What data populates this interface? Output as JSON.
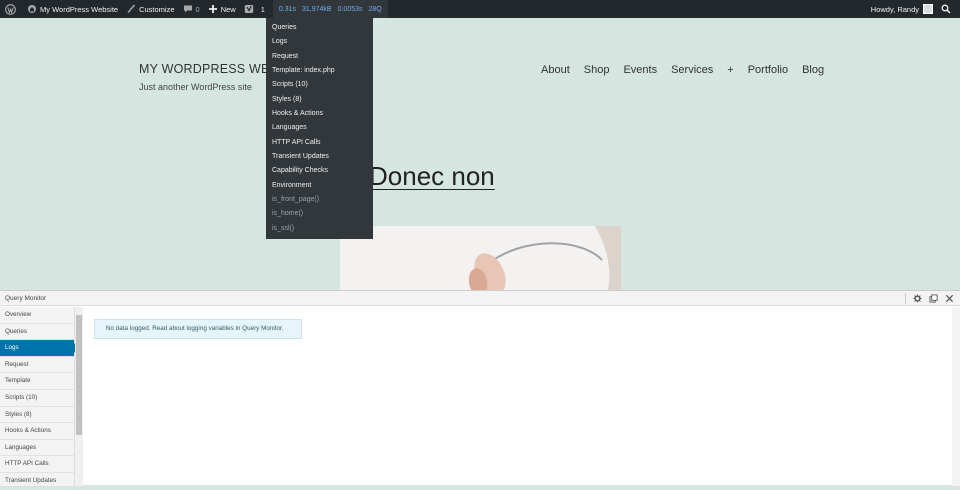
{
  "admin_bar": {
    "site_name": "My WordPress Website",
    "customize": "Customize",
    "comments_count": "0",
    "new_label": "New",
    "yoast_count": "1",
    "qm_stats": [
      "0.31s",
      "31,974kB",
      "0.0053s",
      "28Q"
    ],
    "howdy": "Howdy, Randy"
  },
  "qm_menu": {
    "items": [
      "Queries",
      "Logs",
      "Request",
      "Template: index.php",
      "Scripts (10)",
      "Styles (8)",
      "Hooks & Actions",
      "Languages",
      "HTTP API Calls",
      "Transient Updates",
      "Capability Checks",
      "Environment"
    ],
    "conditionals": [
      "is_front_page()",
      "is_home()",
      "is_ssl()"
    ]
  },
  "site": {
    "title": "MY WORDPRESS WEBSITE",
    "description": "Just another WordPress site",
    "nav": [
      "About",
      "Shop",
      "Events",
      "Services",
      "+",
      "Portfolio",
      "Blog"
    ],
    "post_title": "Donec non"
  },
  "qm_panel": {
    "title": "Query Monitor",
    "sidebar": [
      "Overview",
      "Queries",
      "Logs",
      "Request",
      "Template",
      "Scripts (10)",
      "Styles (8)",
      "Hooks & Actions",
      "Languages",
      "HTTP API Calls",
      "Transient Updates"
    ],
    "active_item": "Logs",
    "notice": "No data logged. Read about logging variables in Query Monitor."
  },
  "icons": [
    "wordpress-logo-icon",
    "home-icon",
    "brush-icon",
    "comment-icon",
    "plus-icon",
    "yoast-icon",
    "search-icon",
    "gear-icon",
    "popout-icon",
    "close-icon"
  ]
}
